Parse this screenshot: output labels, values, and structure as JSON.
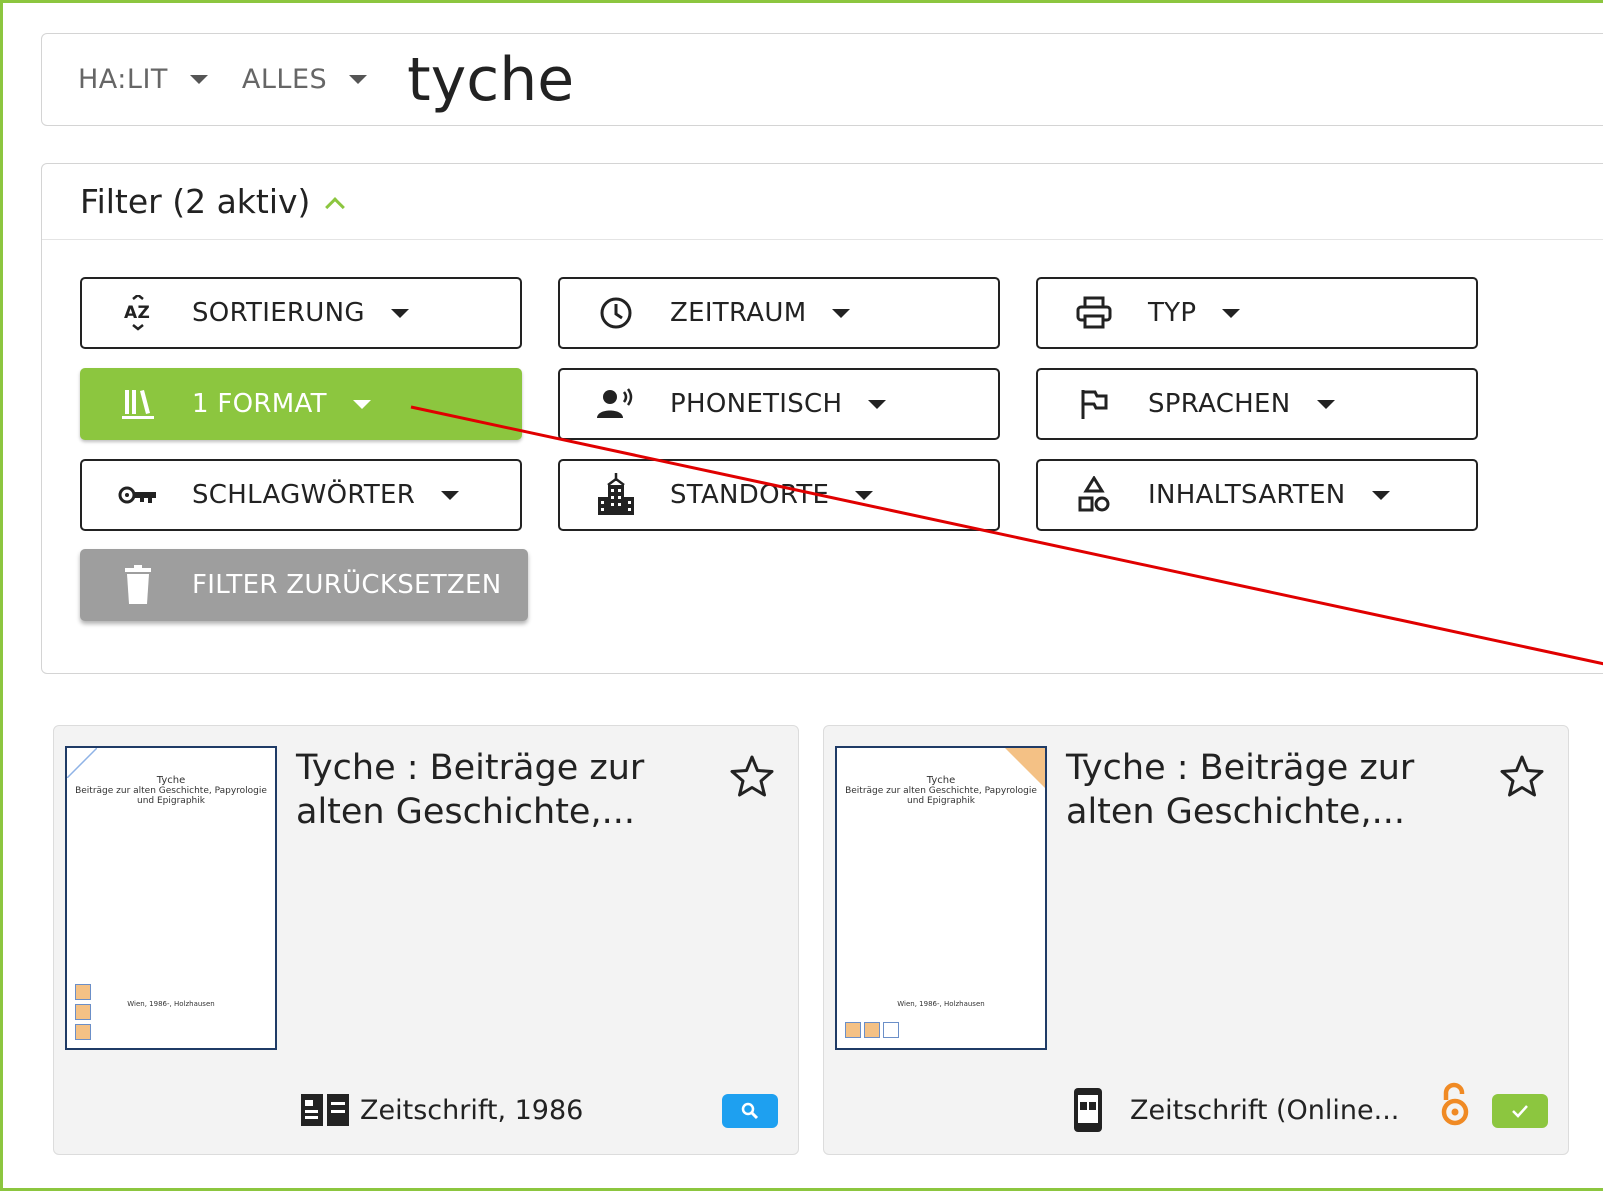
{
  "search": {
    "scope_label": "HA:LIT",
    "field_label": "ALLES",
    "query": "tyche"
  },
  "filter": {
    "header": "Filter (2 aktiv)",
    "buttons": [
      {
        "label": "SORTIERUNG",
        "icon": "sort-az-icon"
      },
      {
        "label": "ZEITRAUM",
        "icon": "clock-icon"
      },
      {
        "label": "TYP",
        "icon": "printer-icon"
      },
      {
        "label": "1 FORMAT",
        "icon": "library-books-icon",
        "active": true
      },
      {
        "label": "PHONETISCH",
        "icon": "voice-person-icon"
      },
      {
        "label": "SPRACHEN",
        "icon": "flag-icon"
      },
      {
        "label": "SCHLAGWÖRTER",
        "icon": "key-icon"
      },
      {
        "label": "STANDORTE",
        "icon": "building-icon"
      },
      {
        "label": "INHALTSARTEN",
        "icon": "shapes-icon"
      }
    ],
    "reset_label": "FILTER ZURÜCKSETZEN"
  },
  "results": [
    {
      "title": "Tyche : Beiträge zur alten Geschichte,...",
      "cover_title": "Tyche",
      "cover_subtitle": "Beiträge zur alten Geschichte, Papyrologie und Epigraphik",
      "cover_imprint": "Wien, 1986-, Holzhausen",
      "meta": "Zeitschrift, 1986",
      "format_icon": "print-journal-icon",
      "badges": [
        "search-badge"
      ]
    },
    {
      "title": "Tyche : Beiträge zur alten Geschichte,...",
      "cover_title": "Tyche",
      "cover_subtitle": "Beiträge zur alten Geschichte, Papyrologie und Epigraphik",
      "cover_imprint": "Wien, 1986-, Holzhausen",
      "meta": "Zeitschrift (Online...",
      "format_icon": "online-journal-icon",
      "badges": [
        "open-access-icon",
        "available-badge"
      ]
    }
  ],
  "colors": {
    "accent": "#8cc63f",
    "reset": "#9e9e9e",
    "annotation_arrow": "#e00000",
    "search_badge": "#1ea0f0",
    "open_access": "#f08a24"
  }
}
